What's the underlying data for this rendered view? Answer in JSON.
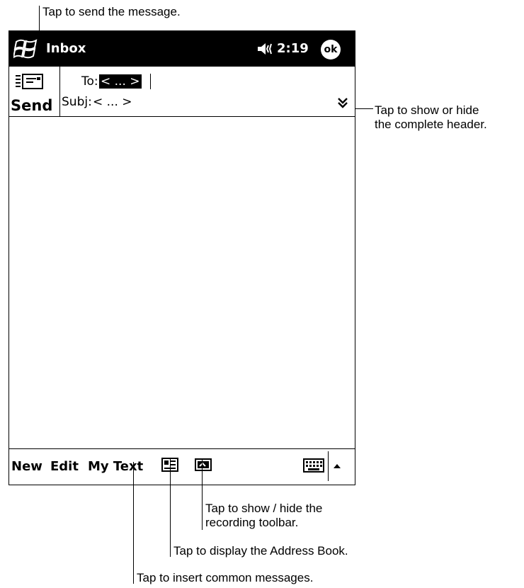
{
  "callouts": {
    "send": "Tap to send the message.",
    "header_line1": "Tap to show or hide",
    "header_line2": "the complete header.",
    "recording_line1": "Tap to show / hide the",
    "recording_line2": "recording toolbar.",
    "address_book": "Tap to display the Address Book.",
    "common_messages": "Tap to insert common messages."
  },
  "titlebar": {
    "app_title": "Inbox",
    "time": "2:19",
    "ok_label": "ok",
    "start_icon": "windows-flag-icon",
    "volume_icon": "speaker-icon"
  },
  "compose": {
    "send_label": "Send",
    "send_icon": "envelope-send-icon",
    "to_label": "To:",
    "to_value": "< ... >",
    "subject_label": "Subj:",
    "subject_value": "< ... >",
    "expand_icon": "double-chevron-down-icon"
  },
  "menubar": {
    "new_label": "New",
    "edit_label": "Edit",
    "mytext_label": "My Text",
    "address_book_icon": "address-card-icon",
    "recording_icon": "recording-icon",
    "keyboard_icon": "keyboard-icon",
    "sip_arrow_icon": "up-arrow-icon"
  }
}
